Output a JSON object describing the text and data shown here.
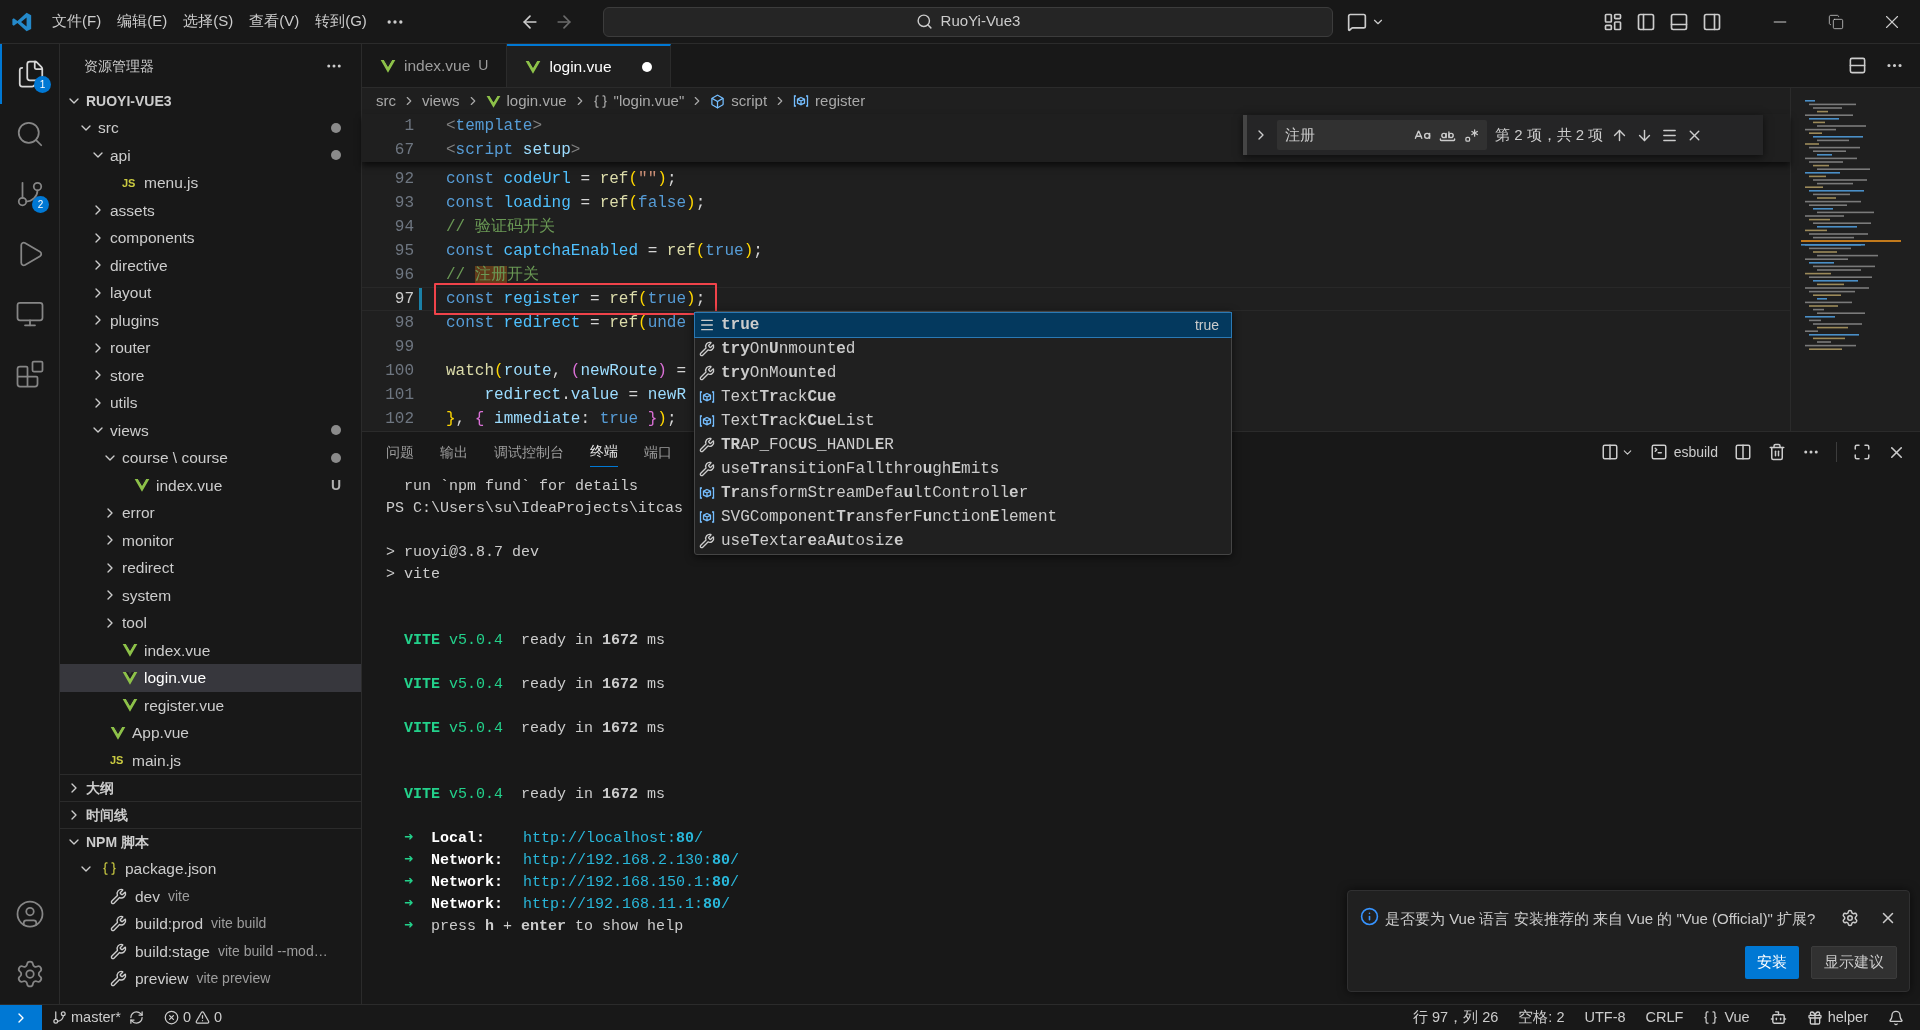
{
  "title_bar": {
    "menus": [
      "文件(F)",
      "编辑(E)",
      "选择(S)",
      "查看(V)",
      "转到(G)"
    ],
    "search": "RuoYi-Vue3"
  },
  "activity_bar": {
    "items": [
      {
        "kind": "explorer",
        "selected": true,
        "badge": "1"
      },
      {
        "kind": "search",
        "selected": false
      },
      {
        "kind": "source_control",
        "selected": false,
        "badge": "2"
      },
      {
        "kind": "run",
        "selected": false
      },
      {
        "kind": "remote",
        "selected": false
      },
      {
        "kind": "extensions",
        "selected": false
      }
    ],
    "bottom": [
      {
        "kind": "account"
      },
      {
        "kind": "settings"
      }
    ]
  },
  "explorer": {
    "title": "资源管理器",
    "root": {
      "title": "RUOYI-VUE3",
      "expanded": true,
      "tree": [
        {
          "name": "src",
          "kind": "folder",
          "expanded": true,
          "selected": false,
          "changed": true,
          "children": [
            {
              "name": "api",
              "kind": "folder",
              "expanded": true,
              "selected": false,
              "changed": true,
              "children": [
                {
                  "name": "menu.js",
                  "kind": "js",
                  "icon": "JS",
                  "selected": false,
                  "changed": false
                }
              ]
            },
            {
              "name": "assets",
              "kind": "folder",
              "expanded": false,
              "selected": false,
              "changed": false
            },
            {
              "name": "components",
              "kind": "folder",
              "expanded": false,
              "selected": false,
              "changed": false
            },
            {
              "name": "directive",
              "kind": "folder",
              "expanded": false,
              "selected": false,
              "changed": false
            },
            {
              "name": "layout",
              "kind": "folder",
              "expanded": false,
              "selected": false,
              "changed": false
            },
            {
              "name": "plugins",
              "kind": "folder",
              "expanded": false,
              "selected": false,
              "changed": false
            },
            {
              "name": "router",
              "kind": "folder",
              "expanded": false,
              "selected": false,
              "changed": false
            },
            {
              "name": "store",
              "kind": "folder",
              "expanded": false,
              "selected": false,
              "changed": false
            },
            {
              "name": "utils",
              "kind": "folder",
              "expanded": false,
              "selected": false,
              "changed": false
            },
            {
              "name": "views",
              "kind": "folder",
              "expanded": true,
              "selected": false,
              "changed": true,
              "children": [
                {
                  "name": "course \\ course",
                  "kind": "folder",
                  "expanded": true,
                  "selected": false,
                  "changed": true,
                  "children": [
                    {
                      "name": "index.vue",
                      "kind": "vue",
                      "selected": false,
                      "changed": false,
                      "status": "U"
                    }
                  ]
                },
                {
                  "name": "error",
                  "kind": "folder",
                  "expanded": false,
                  "selected": false,
                  "changed": false
                },
                {
                  "name": "monitor",
                  "kind": "folder",
                  "expanded": false,
                  "selected": false,
                  "changed": false
                },
                {
                  "name": "redirect",
                  "kind": "folder",
                  "expanded": false,
                  "selected": false,
                  "changed": false
                },
                {
                  "name": "system",
                  "kind": "folder",
                  "expanded": false,
                  "selected": false,
                  "changed": false
                },
                {
                  "name": "tool",
                  "kind": "folder",
                  "expanded": false,
                  "selected": false,
                  "changed": false
                },
                {
                  "name": "index.vue",
                  "kind": "vue",
                  "selected": false,
                  "changed": false
                },
                {
                  "name": "login.vue",
                  "kind": "vue",
                  "selected": true,
                  "changed": false
                },
                {
                  "name": "register.vue",
                  "kind": "vue",
                  "selected": false,
                  "changed": false
                }
              ]
            },
            {
              "name": "App.vue",
              "kind": "vue",
              "selected": false,
              "changed": false
            },
            {
              "name": "main.js",
              "kind": "js",
              "icon": "JS",
              "selected": false,
              "changed": false
            }
          ]
        }
      ]
    },
    "sections": [
      {
        "title": "大纲",
        "expanded": false
      },
      {
        "title": "时间线",
        "expanded": false
      }
    ],
    "npm_scripts": {
      "title": "NPM 脚本",
      "expanded": true,
      "file": {
        "name": "package.json",
        "expanded": true,
        "scripts": [
          {
            "name": "dev",
            "command": "vite"
          },
          {
            "name": "build:prod",
            "command": "vite build"
          },
          {
            "name": "build:stage",
            "command": "vite build --mod…"
          },
          {
            "name": "preview",
            "command": "vite preview"
          }
        ]
      }
    }
  },
  "tabs": [
    {
      "label": "index.vue",
      "status": "U",
      "selected": false,
      "modified": false
    },
    {
      "label": "login.vue",
      "selected": true,
      "modified": true
    }
  ],
  "breadcrumbs": [
    {
      "text": "src",
      "kind": "folder"
    },
    {
      "text": "views",
      "kind": "folder"
    },
    {
      "text": "login.vue",
      "kind": "vue"
    },
    {
      "text": "\"login.vue\"",
      "kind": "object"
    },
    {
      "text": "script",
      "kind": "module"
    },
    {
      "text": "register",
      "kind": "variable"
    }
  ],
  "editor": {
    "sticky_lines": [
      {
        "number": "1",
        "tokens": [
          {
            "text": "<",
            "kind": "punct"
          },
          {
            "text": "template",
            "kind": "tag"
          },
          {
            "text": ">",
            "kind": "punct"
          }
        ]
      },
      {
        "number": "67",
        "tokens": [
          {
            "text": "<",
            "kind": "punct"
          },
          {
            "text": "script ",
            "kind": "tag"
          },
          {
            "text": "setup",
            "kind": "attr"
          },
          {
            "text": ">",
            "kind": "punct"
          }
        ]
      }
    ],
    "lines": [
      {
        "number": "92",
        "tokens": [
          {
            "text": "const ",
            "kind": "kw"
          },
          {
            "text": "codeUrl",
            "kind": "const"
          },
          {
            "text": " = ",
            "kind": "text"
          },
          {
            "text": "ref",
            "kind": "fn"
          },
          {
            "text": "(",
            "kind": "br1"
          },
          {
            "text": "\"\"",
            "kind": "str"
          },
          {
            "text": ")",
            "kind": "br1"
          },
          {
            "text": ";",
            "kind": "text"
          }
        ]
      },
      {
        "number": "93",
        "tokens": [
          {
            "text": "const ",
            "kind": "kw"
          },
          {
            "text": "loading",
            "kind": "const"
          },
          {
            "text": " = ",
            "kind": "text"
          },
          {
            "text": "ref",
            "kind": "fn"
          },
          {
            "text": "(",
            "kind": "br1"
          },
          {
            "text": "false",
            "kind": "bool"
          },
          {
            "text": ")",
            "kind": "br1"
          },
          {
            "text": ";",
            "kind": "text"
          }
        ]
      },
      {
        "number": "94",
        "tokens": [
          {
            "text": "// 验证码开关",
            "kind": "cm"
          }
        ]
      },
      {
        "number": "95",
        "tokens": [
          {
            "text": "const ",
            "kind": "kw"
          },
          {
            "text": "captchaEnabled",
            "kind": "const"
          },
          {
            "text": " = ",
            "kind": "text"
          },
          {
            "text": "ref",
            "kind": "fn"
          },
          {
            "text": "(",
            "kind": "br1"
          },
          {
            "text": "true",
            "kind": "bool"
          },
          {
            "text": ")",
            "kind": "br1"
          },
          {
            "text": ";",
            "kind": "text"
          }
        ]
      },
      {
        "number": "96",
        "tokens": [
          {
            "text": "// ",
            "kind": "cm"
          },
          {
            "text": "注册",
            "kind": "match"
          },
          {
            "text": "开关",
            "kind": "cm"
          }
        ]
      },
      {
        "number": "97",
        "current": true,
        "modified": true,
        "annotated": true,
        "tokens": [
          {
            "text": "const ",
            "kind": "kw"
          },
          {
            "text": "register",
            "kind": "const"
          },
          {
            "text": " = ",
            "kind": "text"
          },
          {
            "text": "ref",
            "kind": "fn"
          },
          {
            "text": "(",
            "kind": "br1"
          },
          {
            "text": "true",
            "kind": "bool"
          },
          {
            "text": ")",
            "kind": "br1"
          },
          {
            "text": ";",
            "kind": "text"
          }
        ]
      },
      {
        "number": "98",
        "tokens": [
          {
            "text": "const ",
            "kind": "kw"
          },
          {
            "text": "redirect",
            "kind": "const"
          },
          {
            "text": " = ",
            "kind": "text"
          },
          {
            "text": "ref",
            "kind": "fn"
          },
          {
            "text": "(",
            "kind": "br1"
          },
          {
            "text": "unde",
            "kind": "bool"
          }
        ]
      },
      {
        "number": "99"
      },
      {
        "number": "100",
        "tokens": [
          {
            "text": "watch",
            "kind": "fn"
          },
          {
            "text": "(",
            "kind": "br1"
          },
          {
            "text": "route",
            "kind": "var"
          },
          {
            "text": ", ",
            "kind": "text"
          },
          {
            "text": "(",
            "kind": "br2"
          },
          {
            "text": "newRoute",
            "kind": "var"
          },
          {
            "text": ")",
            "kind": "br2"
          },
          {
            "text": " =",
            "kind": "text"
          }
        ]
      },
      {
        "number": "101",
        "tokens": [
          {
            "text": "    redirect",
            "kind": "var"
          },
          {
            "text": ".",
            "kind": "text"
          },
          {
            "text": "value",
            "kind": "var"
          },
          {
            "text": " = ",
            "kind": "text"
          },
          {
            "text": "newR",
            "kind": "var"
          }
        ]
      },
      {
        "number": "102",
        "tokens": [
          {
            "text": "}",
            "kind": "br1"
          },
          {
            "text": ", ",
            "kind": "text"
          },
          {
            "text": "{",
            "kind": "br2"
          },
          {
            "text": " immediate",
            "kind": "var"
          },
          {
            "text": ": ",
            "kind": "text"
          },
          {
            "text": "true ",
            "kind": "bool"
          },
          {
            "text": "}",
            "kind": "br2"
          },
          {
            "text": ")",
            "kind": "br1"
          },
          {
            "text": ";",
            "kind": "text"
          }
        ]
      }
    ]
  },
  "find_widget": {
    "query": "注册",
    "result": "第 2 项，共 2 项"
  },
  "suggestions": [
    {
      "label": "**true**",
      "kind": "keyword",
      "selected": true,
      "detail": "true"
    },
    {
      "label": "**try**On**U**nmount**e**d",
      "kind": "method",
      "selected": false
    },
    {
      "label": "**try**OnMo**u**nt**e**d",
      "kind": "method",
      "selected": false
    },
    {
      "label": "Text**Tr**ack**Cue**",
      "kind": "variable",
      "selected": false
    },
    {
      "label": "Text**Tr**ack**Cue**List",
      "kind": "variable",
      "selected": false
    },
    {
      "label": "**TR**AP_FOC**U**S_HANDL**E**R",
      "kind": "method",
      "selected": false
    },
    {
      "label": "use**Tr**ansitionFallthro**u**gh**E**mits",
      "kind": "method",
      "selected": false
    },
    {
      "label": "**Tr**ansformStreamDefa**u**ltControll**e**r",
      "kind": "variable",
      "selected": false
    },
    {
      "label": "SVGComponent**Tr**ansferF**u**nction**E**lement",
      "kind": "variable",
      "selected": false
    },
    {
      "label": "use**T**extar**e**a**Au**tosiz**e**",
      "kind": "method",
      "selected": false
    }
  ],
  "panel": {
    "tabs": [
      {
        "label": "问题",
        "selected": false
      },
      {
        "label": "输出",
        "selected": false
      },
      {
        "label": "调试控制台",
        "selected": false
      },
      {
        "label": "终端",
        "selected": true
      },
      {
        "label": "端口",
        "selected": false
      }
    ],
    "terminal_name": "esbuild",
    "lines": [
      {
        "kind": "text",
        "text": "  run `npm fund` for details"
      },
      {
        "kind": "text",
        "text": "PS C:\\Users\\su\\IdeaProjects\\itcas"
      },
      {
        "kind": "blank"
      },
      {
        "kind": "text",
        "text": "> ruoyi@3.8.7 dev"
      },
      {
        "kind": "text",
        "text": "> vite"
      },
      {
        "kind": "blank"
      },
      {
        "kind": "blank"
      },
      {
        "kind": "vite",
        "name": "VITE",
        "version": "v5.0.4",
        "text": "ready in **1672** ms"
      },
      {
        "kind": "blank"
      },
      {
        "kind": "vite",
        "name": "VITE",
        "version": "v5.0.4",
        "text": "ready in **1672** ms"
      },
      {
        "kind": "blank"
      },
      {
        "kind": "vite",
        "name": "VITE",
        "version": "v5.0.4",
        "text": "ready in **1672** ms"
      },
      {
        "kind": "blank"
      },
      {
        "kind": "blank"
      },
      {
        "kind": "vite",
        "name": "VITE",
        "version": "v5.0.4",
        "text": "ready in **1672** ms"
      },
      {
        "kind": "blank"
      },
      {
        "kind": "url",
        "arrow": "➜",
        "label": "Local:",
        "url": "http://localhost:**80**/"
      },
      {
        "kind": "url",
        "arrow": "➜",
        "label": "Network:",
        "url": "http://192.168.2.130:**80**/"
      },
      {
        "kind": "url",
        "arrow": "➜",
        "label": "Network:",
        "url": "http://192.168.150.1:**80**/"
      },
      {
        "kind": "url",
        "arrow": "➜",
        "label": "Network:",
        "url": "http://192.168.11.1:**80**/"
      },
      {
        "kind": "help",
        "arrow": "➜",
        "text": "press **h** + **enter** to show help"
      }
    ]
  },
  "notification": {
    "message": "是否要为 Vue 语言 安装推荐的 来自 Vue 的 \"Vue (Official)\" 扩展?",
    "buttons": [
      {
        "label": "安装",
        "primary": true
      },
      {
        "label": "显示建议",
        "primary": false
      }
    ]
  },
  "status_bar": {
    "branch": "master*",
    "errors": "0",
    "warnings": "0",
    "items": [
      "行 97，列 26",
      "空格: 2",
      "UTF-8",
      "CRLF"
    ],
    "language": "Vue",
    "account": "helper"
  }
}
